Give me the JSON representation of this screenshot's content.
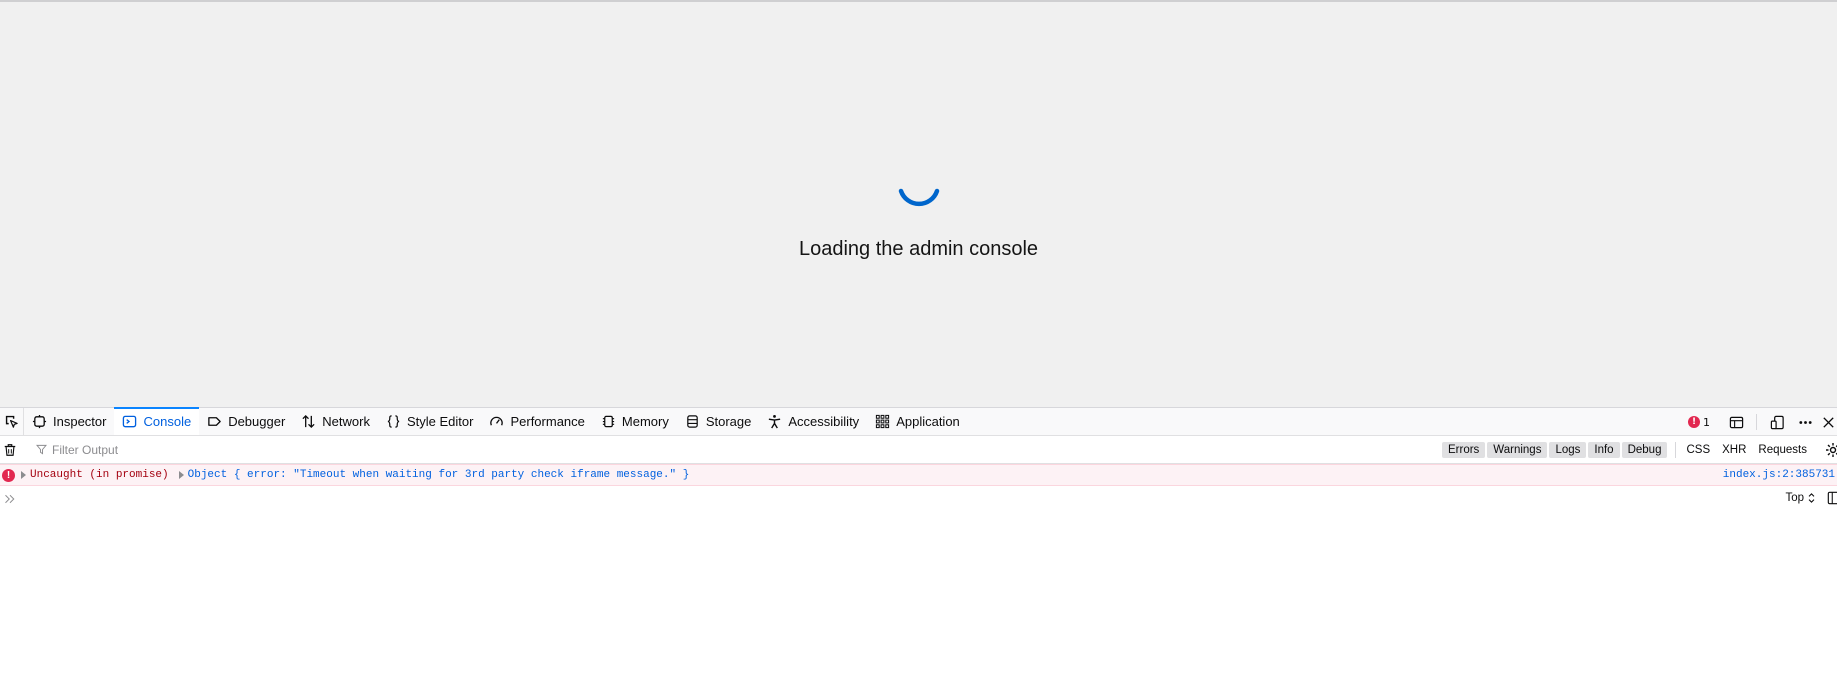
{
  "page": {
    "loading_title": "Loading the admin console"
  },
  "devtools": {
    "tabs": [
      {
        "label": "Inspector",
        "icon": "inspector-icon"
      },
      {
        "label": "Console",
        "icon": "console-icon",
        "selected": true
      },
      {
        "label": "Debugger",
        "icon": "debugger-icon"
      },
      {
        "label": "Network",
        "icon": "network-icon"
      },
      {
        "label": "Style Editor",
        "icon": "style-editor-icon"
      },
      {
        "label": "Performance",
        "icon": "performance-icon"
      },
      {
        "label": "Memory",
        "icon": "memory-icon"
      },
      {
        "label": "Storage",
        "icon": "storage-icon"
      },
      {
        "label": "Accessibility",
        "icon": "accessibility-icon"
      },
      {
        "label": "Application",
        "icon": "application-icon"
      }
    ],
    "error_count": "1",
    "filter": {
      "placeholder": "Filter Output",
      "levels": [
        "Errors",
        "Warnings",
        "Logs",
        "Info",
        "Debug"
      ],
      "net_filters": [
        "CSS",
        "XHR",
        "Requests"
      ]
    },
    "messages": [
      {
        "level": "error",
        "prefix": "Uncaught (in promise)",
        "body": "Object { error: \"Timeout when waiting for 3rd party check iframe message.\" }",
        "location": "index.js:2:385731"
      }
    ],
    "context_selector": "Top"
  },
  "colors": {
    "accent": "#0060df",
    "error": "#e22850",
    "viewport_bg": "#f0f0f0",
    "spinner": "#0066cc"
  }
}
